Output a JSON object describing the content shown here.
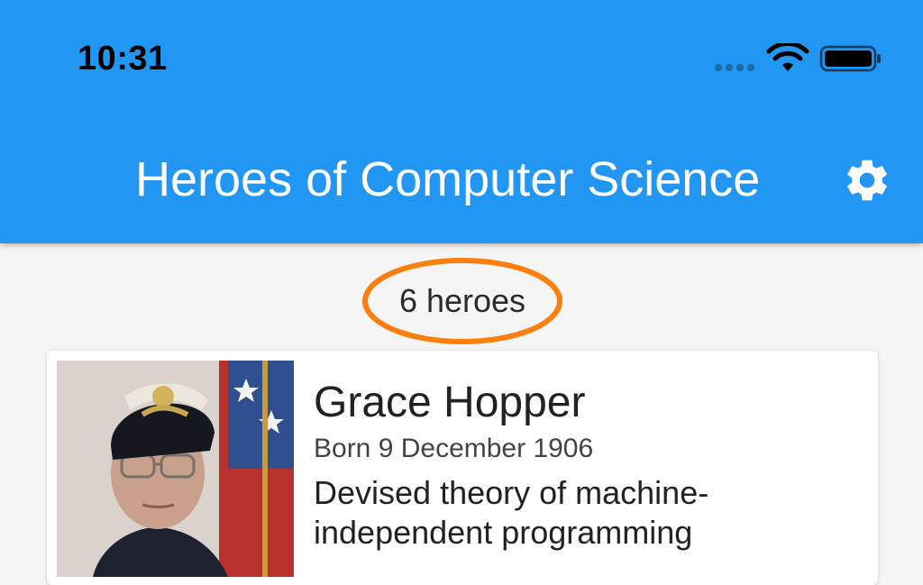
{
  "status_bar": {
    "time": "10:31",
    "signal_icon": "cellular-dots-icon",
    "wifi_icon": "wifi-icon",
    "battery_icon": "battery-full-icon"
  },
  "app_bar": {
    "title": "Heroes of Computer Science",
    "settings_icon": "gear-icon",
    "color": "#2196f3"
  },
  "hero_count": {
    "text": "6 heroes",
    "highlight_color": "#ff7f0e"
  },
  "heroes": [
    {
      "name": "Grace Hopper",
      "born": "Born 9 December 1906",
      "description": "Devised theory of machine-independent programming",
      "photo": "grace-hopper-portrait"
    }
  ]
}
